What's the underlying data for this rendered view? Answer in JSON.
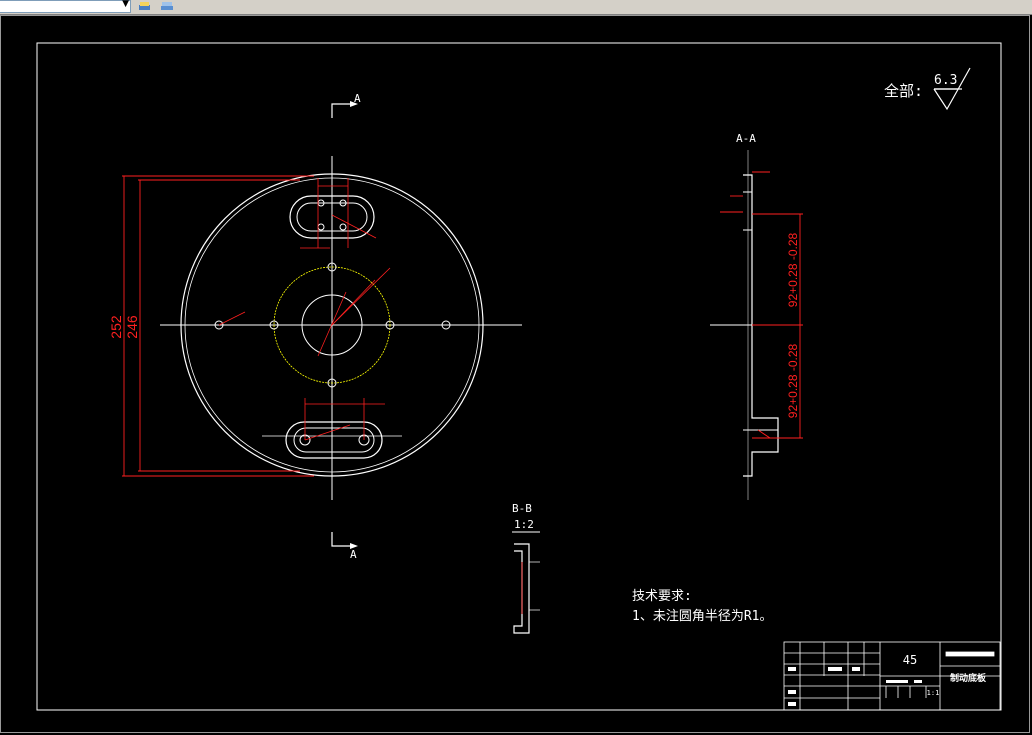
{
  "colors": {
    "background": "#000000",
    "outline": "#ffffff",
    "dimension": "#ff2020",
    "centerline": "#ffffff",
    "thread": "#ffff00"
  },
  "toolbar": {
    "layer_combo_value": "",
    "icons": [
      "layer-state-icon",
      "layer-properties-icon"
    ]
  },
  "roughness": {
    "prefix": "全部:",
    "value": "6.3"
  },
  "section_labels": {
    "cut_top": "A",
    "cut_bottom": "A",
    "section_aa": "A-A",
    "section_bb": "B-B",
    "section_bb_scale": "1:2"
  },
  "dimensions": {
    "outer_dia_left": "252",
    "inner_dia_left": "246",
    "side_upper": "92+0.28 -0.28",
    "side_lower": "92+0.28 -0.28"
  },
  "notes": {
    "title": "技术要求:",
    "line1": "1、未注圆角半径为R1。"
  },
  "title_block": {
    "material": "45",
    "part_name": "制动底板",
    "scale": "1:1"
  }
}
